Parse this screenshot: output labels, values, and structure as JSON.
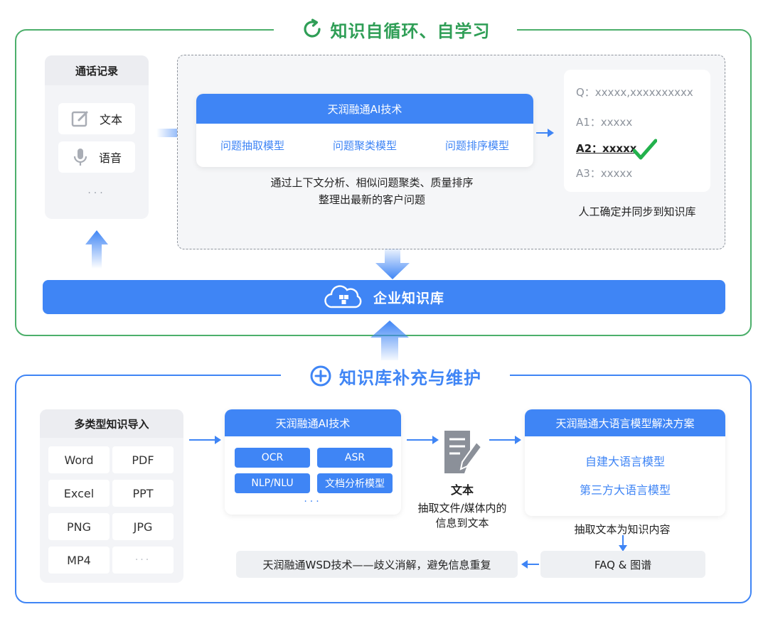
{
  "top_section": {
    "title": "知识自循环、自学习",
    "call_records": {
      "title": "通话记录",
      "items": [
        {
          "label": "文本",
          "icon": "edit-icon"
        },
        {
          "label": "语音",
          "icon": "microphone-icon"
        }
      ],
      "more": "···"
    },
    "ai_tech": {
      "title": "天润融通AI技术",
      "models": [
        "问题抽取模型",
        "问题聚类模型",
        "问题排序模型"
      ]
    },
    "caption": [
      "通过上下文分析、相似问题聚类、质量排序",
      "整理出最新的客户问题"
    ],
    "qa": {
      "items": [
        "Q：xxxxx,xxxxxxxxxx",
        "A1：xxxxx",
        "A2：xxxxx",
        "A3：xxxxx"
      ],
      "selected_index": 2,
      "caption": "人工确定并同步到知识库"
    }
  },
  "knowledge_base": {
    "label": "企业知识库",
    "icon": "cloud-database-icon"
  },
  "bottom_section": {
    "title": "知识库补充与维护",
    "import": {
      "title": "多类型知识导入",
      "types": [
        "Word",
        "PDF",
        "Excel",
        "PPT",
        "PNG",
        "JPG",
        "MP4",
        "···"
      ]
    },
    "ai_tech": {
      "title": "天润融通AI技术",
      "pills": [
        "OCR",
        "ASR",
        "NLP/NLU",
        "文档分析模型"
      ],
      "more": "···"
    },
    "text_node": {
      "label": "文本",
      "caption": [
        "抽取文件/媒体内的",
        "信息到文本"
      ],
      "icon": "document-edit-icon"
    },
    "llm": {
      "title": "天润融通大语言模型解决方案",
      "items": [
        "自建大语言模型",
        "第三方大语言模型"
      ],
      "caption": "抽取文本为知识内容"
    },
    "faq": "FAQ & 图谱",
    "wsd": "天润融通WSD技术——歧义消解，避免信息重复"
  },
  "colors": {
    "green": "#2f9e56",
    "blue": "#3f85f5",
    "check": "#22b14c"
  }
}
